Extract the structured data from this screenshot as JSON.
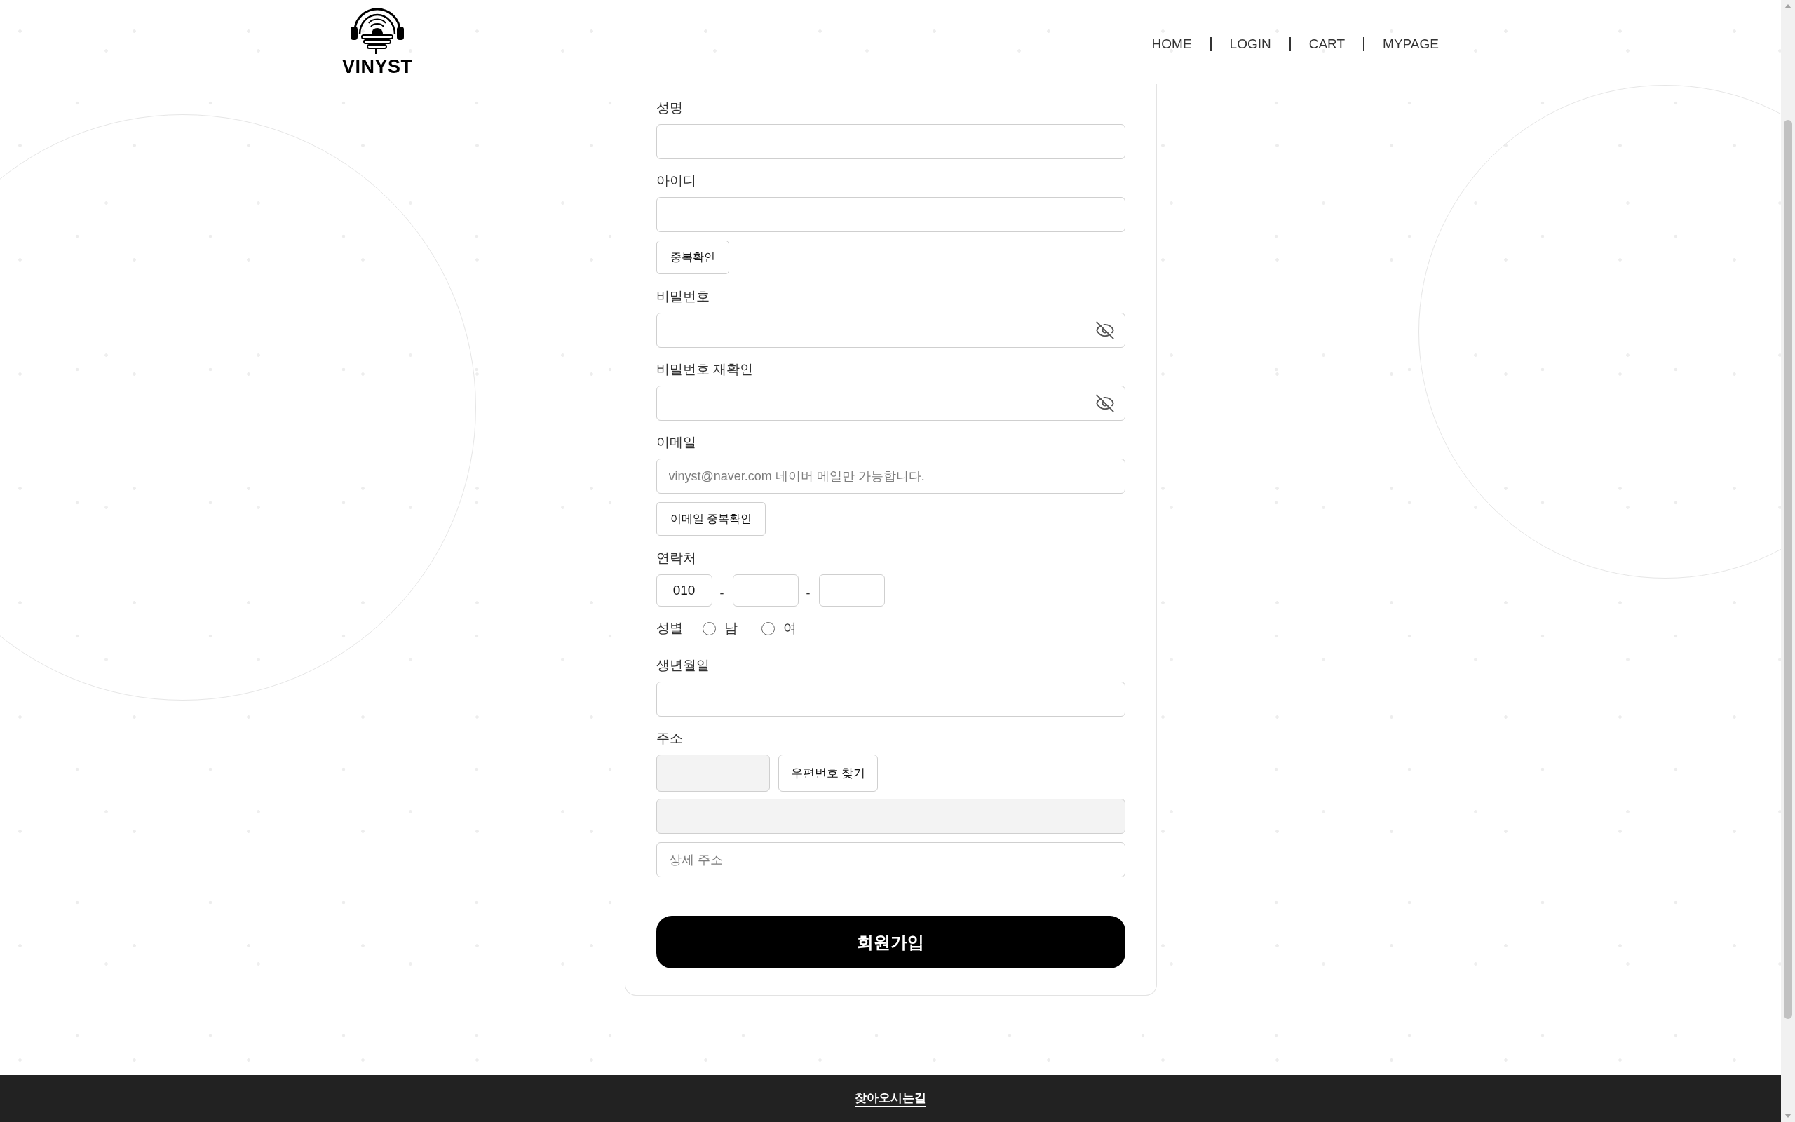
{
  "header": {
    "logo": {
      "text": "VINYST"
    },
    "nav": [
      {
        "label": "HOME"
      },
      {
        "label": "LOGIN"
      },
      {
        "label": "CART"
      },
      {
        "label": "MYPAGE"
      }
    ]
  },
  "signup_form": {
    "fields": [
      {
        "kind": "text",
        "label": "성명"
      },
      {
        "kind": "text",
        "label": "아이디",
        "button": "중복확인"
      },
      {
        "kind": "password",
        "label": "비밀번호",
        "revealed": false
      },
      {
        "kind": "password",
        "label": "비밀번호 재확인",
        "revealed": false
      },
      {
        "kind": "text",
        "label": "이메일",
        "placeholder": "vinyst@naver.com 네이버 메일만 가능합니다.",
        "button": "이메일 중복확인"
      },
      {
        "kind": "phone",
        "label": "연락처",
        "value": "010",
        "separators": [
          "-",
          "-"
        ]
      },
      {
        "kind": "radio",
        "label": "성별",
        "options": [
          {
            "label": "남",
            "selected": false
          },
          {
            "label": "여",
            "selected": false
          }
        ]
      },
      {
        "kind": "text",
        "label": "생년월일"
      },
      {
        "kind": "address",
        "label": "주소",
        "postcode": {
          "readonly": true
        },
        "button": "우편번호 찾기",
        "lines": [
          {
            "readonly": true
          },
          {
            "readonly": false,
            "placeholder": "상세 주소"
          }
        ]
      }
    ],
    "submit": "회원가입"
  },
  "footer": {
    "link": "찾아오시는길"
  }
}
